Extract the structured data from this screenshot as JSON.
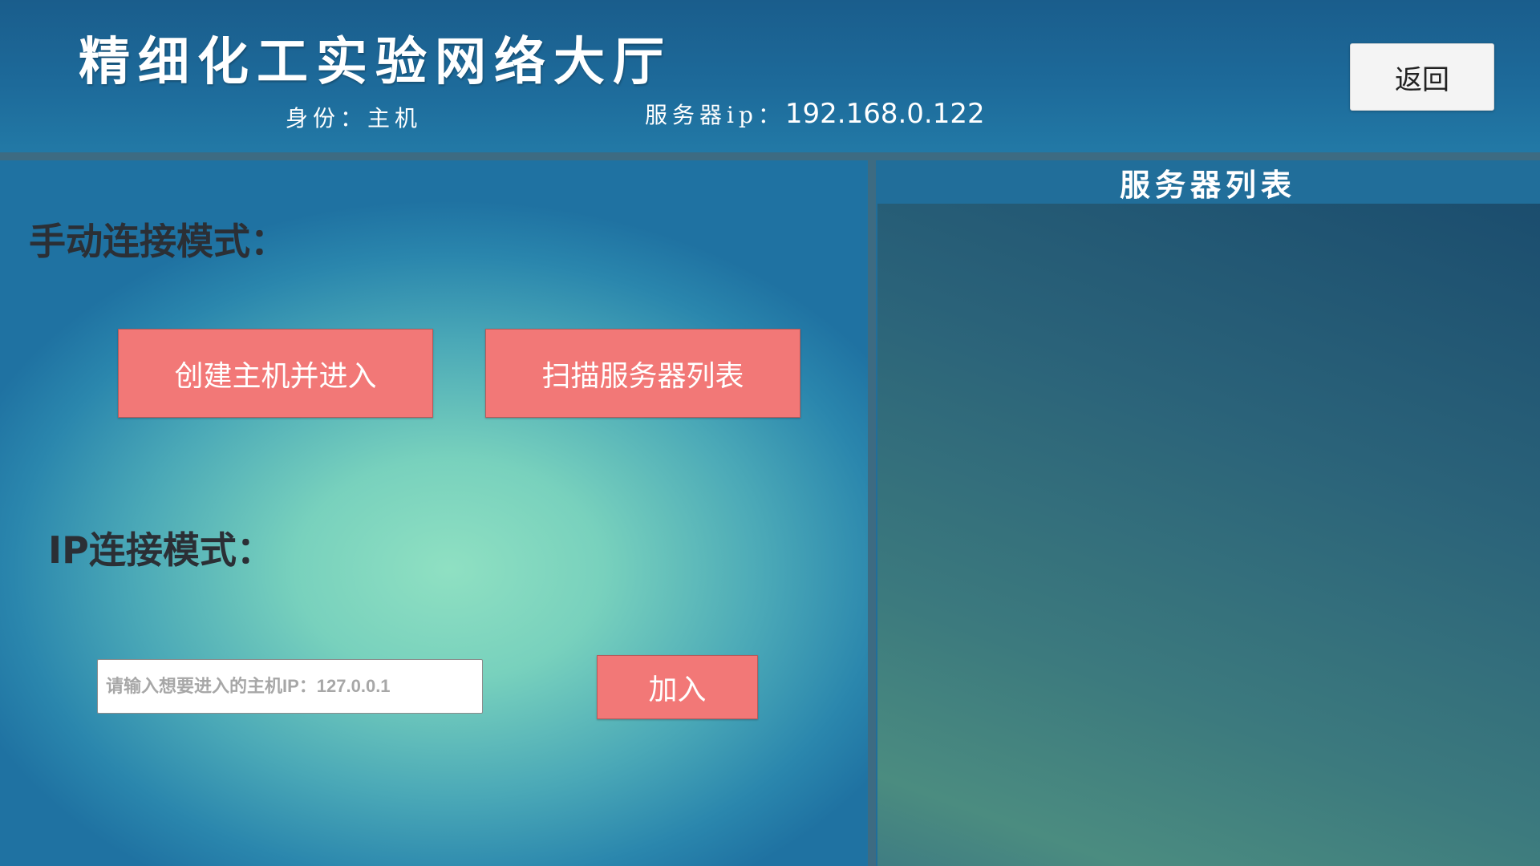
{
  "header": {
    "app_title": "精细化工实验网络大厅",
    "identity": "身份：主机",
    "server_ip_label": "服务器ip：",
    "server_ip_value": "192.168.0.122",
    "back_label": "返回"
  },
  "manual_mode": {
    "label": "手动连接模式：",
    "create_host_label": "创建主机并进入",
    "scan_label": "扫描服务器列表"
  },
  "ip_mode": {
    "label": "IP连接模式：",
    "input_placeholder": "请输入想要进入的主机IP：127.0.0.1",
    "input_value": "",
    "join_label": "加入"
  },
  "server_list": {
    "title": "服务器列表",
    "items": []
  },
  "colors": {
    "header_bg": "#1d6a9a",
    "button_red": "#f27877",
    "divider": "#3d6b82"
  }
}
